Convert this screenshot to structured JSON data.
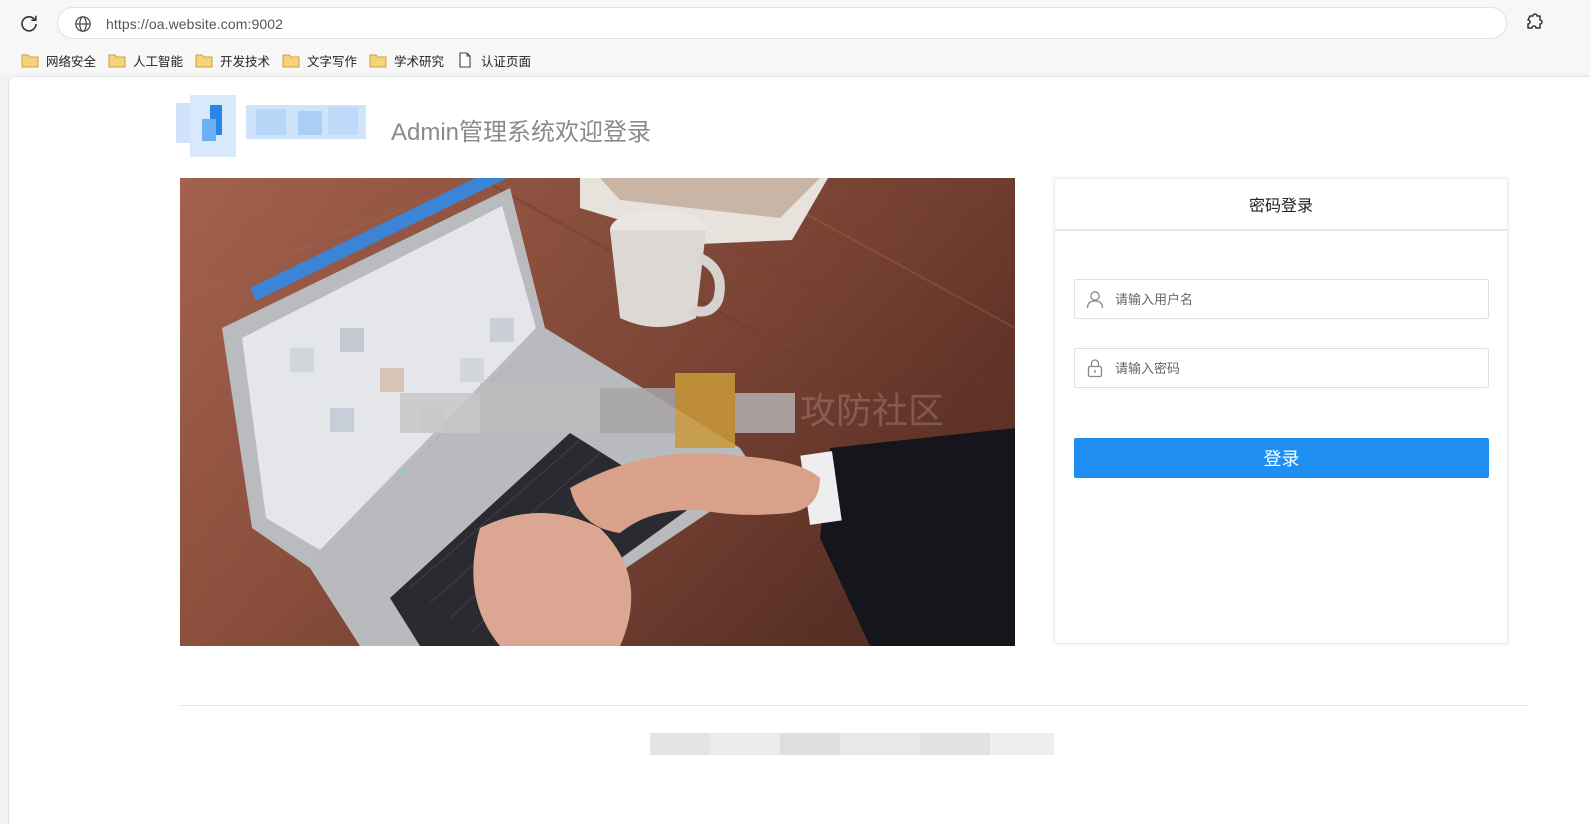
{
  "browser": {
    "url": "https://oa.website.com:9002",
    "bookmarks": [
      {
        "label": "网络安全",
        "icon": "folder-icon"
      },
      {
        "label": "人工智能",
        "icon": "folder-icon"
      },
      {
        "label": "开发技术",
        "icon": "folder-icon"
      },
      {
        "label": "文字写作",
        "icon": "folder-icon"
      },
      {
        "label": "学术研究",
        "icon": "folder-icon"
      },
      {
        "label": "认证页面",
        "icon": "page-icon"
      }
    ]
  },
  "page": {
    "title": "Admin管理系统欢迎登录",
    "watermark": "攻防社区"
  },
  "login": {
    "tab_label": "密码登录",
    "username_placeholder": "请输入用户名",
    "password_placeholder": "请输入密码",
    "submit_label": "登录"
  },
  "colors": {
    "primary": "#1e8ff0",
    "title": "#8a8a8a"
  }
}
